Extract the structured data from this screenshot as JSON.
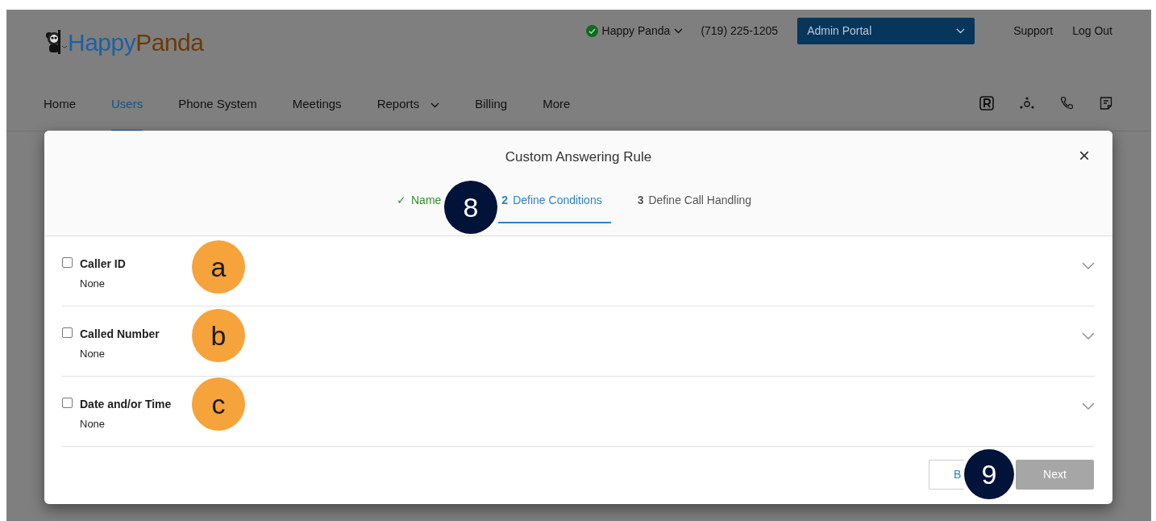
{
  "header": {
    "logo": {
      "first": "Happy",
      "second": "Panda"
    },
    "account": {
      "name": "Happy Panda",
      "online": true
    },
    "phone": "(719) 225-1205",
    "portal": "Admin Portal",
    "links": [
      "Support",
      "Log Out"
    ],
    "nav": [
      {
        "label": "Home",
        "selected": false,
        "dropdown": false
      },
      {
        "label": "Users",
        "selected": true,
        "dropdown": false
      },
      {
        "label": "Phone System",
        "selected": false,
        "dropdown": false
      },
      {
        "label": "Meetings",
        "selected": false,
        "dropdown": false
      },
      {
        "label": "Reports",
        "selected": false,
        "dropdown": true
      },
      {
        "label": "Billing",
        "selected": false,
        "dropdown": false
      },
      {
        "label": "More",
        "selected": false,
        "dropdown": false
      }
    ]
  },
  "dialog": {
    "title": "Custom Answering Rule",
    "close": "×",
    "steps": [
      {
        "number": "✓",
        "label": "Name",
        "kind": "done",
        "selected": false
      },
      {
        "number": "2",
        "label": "Define Conditions",
        "kind": "current",
        "selected": true
      },
      {
        "number": "3",
        "label": "Define Call Handling",
        "kind": "todo",
        "selected": false
      }
    ],
    "conditions": [
      {
        "label": "Caller ID",
        "value": "None",
        "checked": false
      },
      {
        "label": "Called Number",
        "value": "None",
        "checked": false
      },
      {
        "label": "Date and/or Time",
        "value": "None",
        "checked": false
      }
    ],
    "buttons": [
      {
        "label": "B",
        "kind": "back",
        "disabled": false
      },
      {
        "label": "Next",
        "kind": "next",
        "disabled": true
      }
    ]
  },
  "callouts": [
    {
      "label": "a",
      "kind": "letter"
    },
    {
      "label": "b",
      "kind": "letter"
    },
    {
      "label": "c",
      "kind": "letter"
    },
    {
      "label": "8",
      "kind": "number"
    },
    {
      "label": "9",
      "kind": "number"
    }
  ]
}
